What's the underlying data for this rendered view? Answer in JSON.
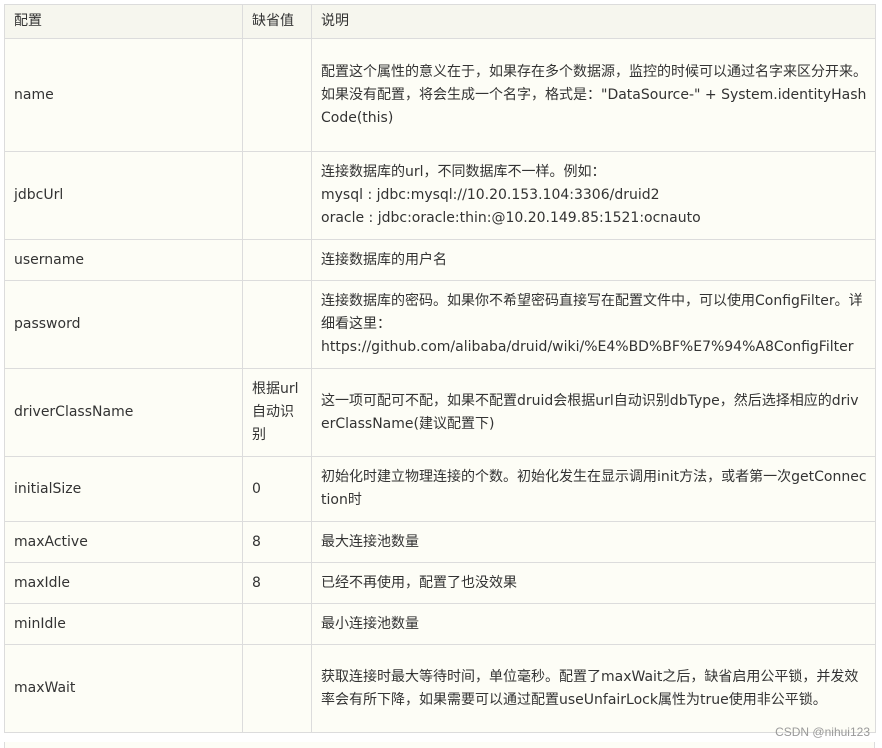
{
  "table": {
    "headers": [
      "配置",
      "缺省值",
      "说明"
    ],
    "rows": [
      {
        "name": "name",
        "default": "",
        "desc": [
          "配置这个属性的意义在于，如果存在多个数据源，监控的时候可以通过名字来区分开来。",
          "如果没有配置，将会生成一个名字，格式是：\"DataSource-\" + System.identityHashCode(this)"
        ]
      },
      {
        "name": "jdbcUrl",
        "default": "",
        "desc": [
          "连接数据库的url，不同数据库不一样。例如：",
          "mysql : jdbc:mysql://10.20.153.104:3306/druid2",
          "oracle : jdbc:oracle:thin:@10.20.149.85:1521:ocnauto"
        ]
      },
      {
        "name": "username",
        "default": "",
        "desc": [
          "连接数据库的用户名"
        ]
      },
      {
        "name": "password",
        "default": "",
        "desc": [
          "连接数据库的密码。如果你不希望密码直接写在配置文件中，可以使用ConfigFilter。详细看这里：",
          "https://github.com/alibaba/druid/wiki/%E4%BD%BF%E7%94%A8ConfigFilter"
        ]
      },
      {
        "name": "driverClassName",
        "default": "根据url自动识别",
        "desc": [
          "这一项可配可不配，如果不配置druid会根据url自动识别dbType，然后选择相应的driverClassName(建议配置下)"
        ]
      },
      {
        "name": "initialSize",
        "default": "0",
        "desc": [
          "初始化时建立物理连接的个数。初始化发生在显示调用init方法，或者第一次getConnection时"
        ]
      },
      {
        "name": "maxActive",
        "default": "8",
        "desc": [
          "最大连接池数量"
        ]
      },
      {
        "name": "maxIdle",
        "default": "8",
        "desc": [
          "已经不再使用，配置了也没效果"
        ]
      },
      {
        "name": "minIdle",
        "default": "",
        "desc": [
          "最小连接池数量"
        ]
      },
      {
        "name": "maxWait",
        "default": "",
        "desc": [
          "获取连接时最大等待时间，单位毫秒。配置了maxWait之后，缺省启用公平锁，并发效率会有所下降，如果需要可以通过配置useUnfairLock属性为true使用非公平锁。"
        ]
      }
    ]
  },
  "watermark": "CSDN @nihui123"
}
